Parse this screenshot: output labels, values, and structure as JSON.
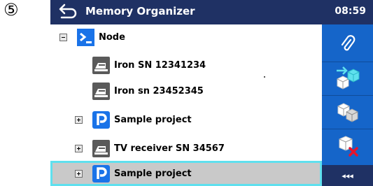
{
  "step_marker": "⑤",
  "window": {
    "title": "Memory Organizer",
    "time": "08:59"
  },
  "tree": [
    {
      "label": "Node",
      "icon": "node-icon",
      "toggle": "minus"
    },
    {
      "label": "Iron SN 12341234",
      "icon": "appliance-icon"
    },
    {
      "label": "Iron sn 23452345",
      "icon": "appliance-icon"
    },
    {
      "label": "Sample project",
      "icon": "project-icon",
      "toggle": "plus"
    },
    {
      "label": "TV receiver SN 34567",
      "icon": "appliance-icon",
      "toggle": "plus"
    },
    {
      "label": "Sample project",
      "icon": "project-icon",
      "toggle": "plus",
      "selected": true
    }
  ],
  "side_buttons": [
    {
      "name": "attach-button",
      "icon": "paperclip-icon"
    },
    {
      "name": "add-structure-button",
      "icon": "add-cube-icon"
    },
    {
      "name": "clone-structure-button",
      "icon": "cubes-icon"
    },
    {
      "name": "delete-structure-button",
      "icon": "delete-cube-icon"
    }
  ],
  "more_label": "◂◂◂",
  "colors": {
    "titlebar": "#1f3164",
    "sidebar": "#1565c9",
    "selection": "#5fe0ee"
  }
}
